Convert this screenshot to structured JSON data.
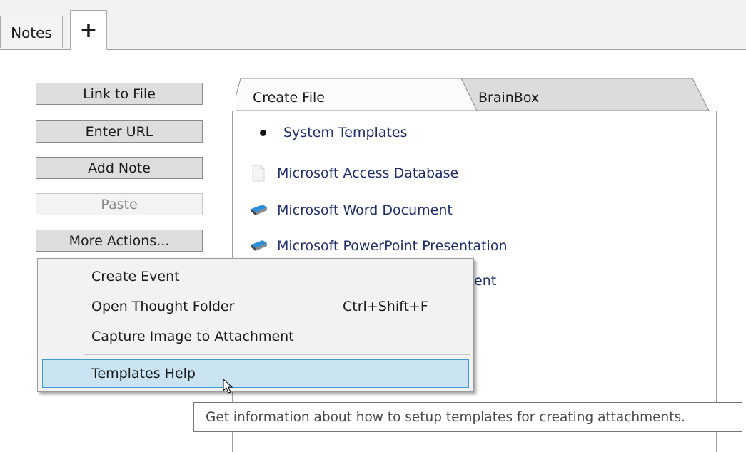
{
  "tabs": {
    "notes_label": "Notes",
    "add_label": "+"
  },
  "actions": {
    "link_to_file": "Link to File",
    "enter_url": "Enter URL",
    "add_note": "Add Note",
    "paste": "Paste",
    "more_actions": "More Actions..."
  },
  "panel_tabs": {
    "create_file": "Create File",
    "brainbox": "BrainBox"
  },
  "templates": [
    {
      "label": "System Templates",
      "icon": "bullet"
    },
    {
      "label": "Microsoft Access Database",
      "icon": "blank-file-icon"
    },
    {
      "label": "Microsoft Word Document",
      "icon": "shortcut-file-icon"
    },
    {
      "label": "Microsoft PowerPoint Presentation",
      "icon": "shortcut-file-icon"
    },
    {
      "partial_label": "ent"
    }
  ],
  "context_menu": {
    "items": [
      {
        "label": "Create Event",
        "shortcut": ""
      },
      {
        "label": "Open Thought Folder",
        "shortcut": "Ctrl+Shift+F"
      },
      {
        "label": "Capture Image to Attachment",
        "shortcut": ""
      },
      {
        "label": "Templates Help",
        "shortcut": "",
        "highlighted": true
      }
    ]
  },
  "tooltip": "Get information about how to setup templates for creating attachments."
}
